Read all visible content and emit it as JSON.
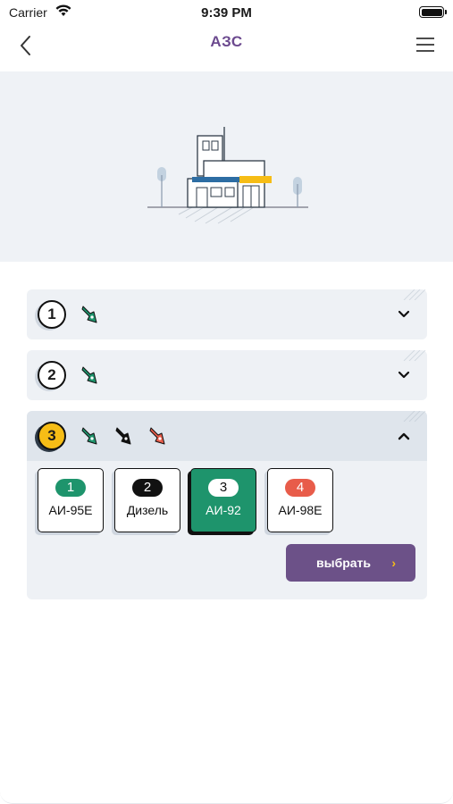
{
  "status_bar": {
    "carrier": "Carrier",
    "time": "9:39 PM"
  },
  "nav": {
    "title": "АЗС"
  },
  "colors": {
    "accent": "#6c4a8f",
    "green": "#1e946c",
    "black": "#111111",
    "red": "#e85c4a",
    "yellow": "#f6bd16"
  },
  "pumps": [
    {
      "number": "1",
      "nozzle_colors": [
        "#1e946c"
      ],
      "expanded": false
    },
    {
      "number": "2",
      "nozzle_colors": [
        "#1e946c"
      ],
      "expanded": false
    },
    {
      "number": "3",
      "nozzle_colors": [
        "#1e946c",
        "#111111",
        "#e85c4a"
      ],
      "expanded": true
    }
  ],
  "fuels": [
    {
      "badge": "1",
      "name": "АИ-95Е",
      "badge_color": "#1e946c",
      "selected": false
    },
    {
      "badge": "2",
      "name": "Дизель",
      "badge_color": "#111111",
      "selected": false
    },
    {
      "badge": "3",
      "name": "АИ-92",
      "badge_color": "#ffffff",
      "selected": true
    },
    {
      "badge": "4",
      "name": "АИ-98Е",
      "badge_color": "#e85c4a",
      "selected": false
    }
  ],
  "choose_button": {
    "label": "выбрать",
    "arrow": "›"
  },
  "icons": {
    "back": "chevron-left-icon",
    "menu": "hamburger-menu-icon",
    "nozzle": "fuel-nozzle-icon",
    "chevron_down": "chevron-down-icon",
    "chevron_up": "chevron-up-icon"
  }
}
